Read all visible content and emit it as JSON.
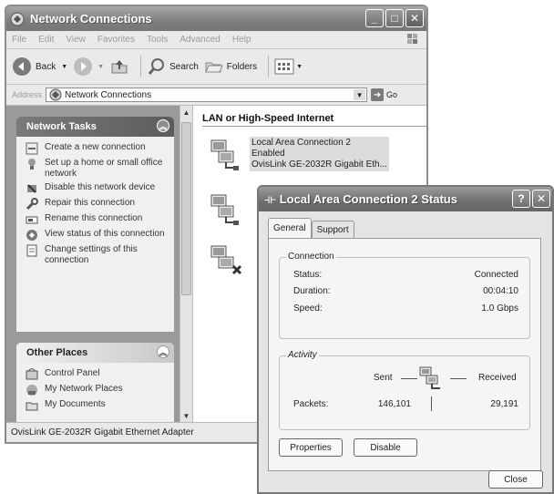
{
  "window": {
    "title": "Network Connections",
    "buttons": [
      "_",
      "□",
      "✕"
    ]
  },
  "menu": [
    "File",
    "Edit",
    "View",
    "Favorites",
    "Tools",
    "Advanced",
    "Help"
  ],
  "toolbar": {
    "back_label": "Back",
    "search_label": "Search",
    "folders_label": "Folders"
  },
  "address": {
    "label": "Address",
    "value": "Network Connections",
    "go_label": "Go"
  },
  "network_tasks": {
    "title": "Network Tasks",
    "items": [
      {
        "label": "Create a new connection",
        "icon": "new-connection-icon"
      },
      {
        "label": "Set up a home or small office network",
        "icon": "home-network-icon"
      },
      {
        "label": "Disable this network device",
        "icon": "disable-device-icon"
      },
      {
        "label": "Repair this connection",
        "icon": "repair-icon"
      },
      {
        "label": "Rename this connection",
        "icon": "rename-icon"
      },
      {
        "label": "View status of this connection",
        "icon": "status-icon"
      },
      {
        "label": "Change settings of this connection",
        "icon": "settings-icon"
      }
    ]
  },
  "other_places": {
    "title": "Other Places",
    "items": [
      {
        "label": "Control Panel",
        "icon": "control-panel-icon"
      },
      {
        "label": "My Network Places",
        "icon": "network-places-icon"
      },
      {
        "label": "My Documents",
        "icon": "documents-icon"
      }
    ]
  },
  "section": {
    "title": "LAN or High-Speed Internet",
    "selected_connection": {
      "name": "Local Area Connection 2",
      "status": "Enabled",
      "device": "OvisLink GE-2032R Gigabit Eth..."
    }
  },
  "statusbar": {
    "text": "OvisLink GE-2032R Gigabit Ethernet Adapter"
  },
  "dialog": {
    "title": "Local Area Connection 2 Status",
    "help_button": "?",
    "close_x": "✕",
    "tabs": [
      "General",
      "Support"
    ],
    "connection_group": "Connection",
    "status_label": "Status:",
    "status_value": "Connected",
    "duration_label": "Duration:",
    "duration_value": "00:04:10",
    "speed_label": "Speed:",
    "speed_value": "1.0 Gbps",
    "activity_group": "Activity",
    "sent_label": "Sent",
    "received_label": "Received",
    "packets_label": "Packets:",
    "packets_sent": "146,101",
    "packets_received": "29,191",
    "properties_button": "Properties",
    "disable_button": "Disable",
    "close_button": "Close"
  }
}
